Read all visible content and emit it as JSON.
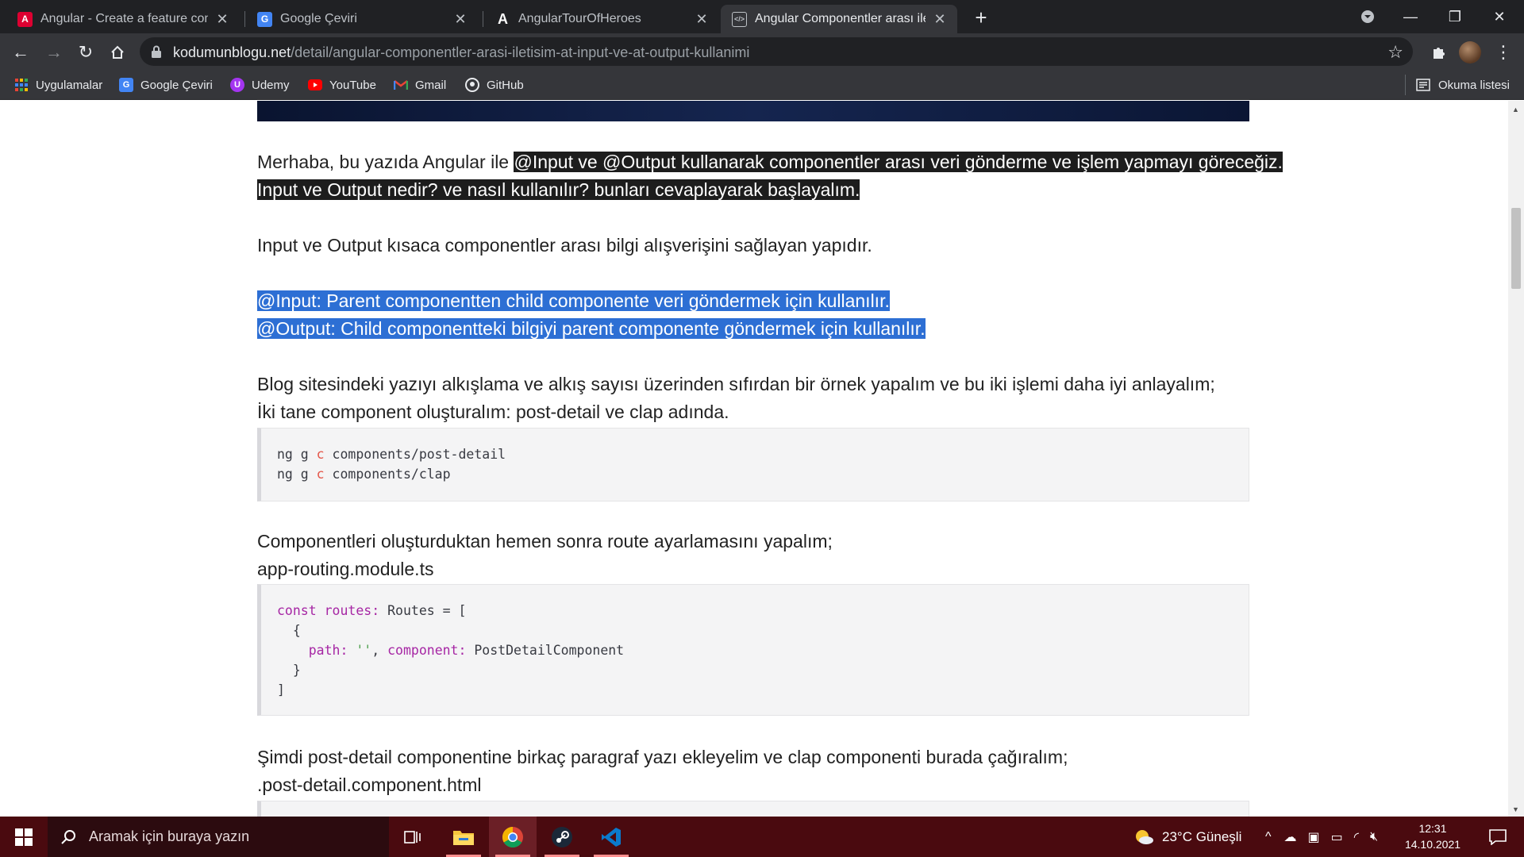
{
  "browser": {
    "tabs": [
      {
        "title": "Angular - Create a feature component",
        "favicon": "angular-red-icon",
        "active": false
      },
      {
        "title": "Google Çeviri",
        "favicon": "google-translate-icon",
        "active": false
      },
      {
        "title": "AngularTourOfHeroes",
        "favicon": "angular-a-icon",
        "active": false
      },
      {
        "title": "Angular Componentler arası iletişim",
        "favicon": "code-icon",
        "active": true
      }
    ],
    "new_tab": "+",
    "window_controls": {
      "minimize": "—",
      "restore": "❐",
      "close": "✕"
    },
    "url_host": "kodumunblogu.net",
    "url_path": "/detail/angular-componentler-arasi-iletisim-at-input-ve-at-output-kullanimi",
    "bookmarks": [
      {
        "label": "Uygulamalar",
        "icon": "apps-grid-icon"
      },
      {
        "label": "Google Çeviri",
        "icon": "google-translate-icon"
      },
      {
        "label": "Udemy",
        "icon": "udemy-icon"
      },
      {
        "label": "YouTube",
        "icon": "youtube-icon"
      },
      {
        "label": "Gmail",
        "icon": "gmail-icon"
      },
      {
        "label": "GitHub",
        "icon": "github-icon"
      }
    ],
    "reading_list": "Okuma listesi"
  },
  "article": {
    "p1_plain": "Merhaba, bu yazıda Angular ile ",
    "p1_highlight": "@Input ve @Output kullanarak componentler arası veri gönderme ve işlem yapmayı göreceğiz.",
    "p1_line2": "Input ve Output nedir? ve nasıl kullanılır? bunları cevaplayarak başlayalım.",
    "p2": "Input ve Output kısaca componentler arası bilgi alışverişini sağlayan yapıdır.",
    "input_def": "@Input: Parent componentten child componente veri göndermek için kullanılır.",
    "output_def": "@Output: Child componentteki bilgiyi parent componente göndermek için kullanılır.",
    "p3_line1": "Blog sitesindeki yazıyı alkışlama ve alkış sayısı üzerinden sıfırdan bir örnek yapalım ve bu iki işlemi daha iyi anlayalım;",
    "p3_line2": "İki tane component oluşturalım: post-detail ve clap adında.",
    "code1": {
      "line1_a": "ng g ",
      "line1_b": "c",
      "line1_c": " components/post-detail",
      "line2_a": "ng g ",
      "line2_b": "c",
      "line2_c": " components/clap"
    },
    "p4_line1": "Componentleri oluşturduktan hemen sonra route ayarlamasını yapalım;",
    "p4_line2": "app-routing.module.ts",
    "code2": {
      "l1_kw": "const",
      "l1_var": " routes",
      "l1_colon": ":",
      "l1_rest": " Routes = [",
      "l2": "  {",
      "l3_prop1": "    path:",
      "l3_str": " ''",
      "l3_comma": ",",
      "l3_prop2": " component:",
      "l3_val": " PostDetailComponent",
      "l4": "  }",
      "l5": "]"
    },
    "p5_line1": "Şimdi post-detail componentine birkaç paragraf yazı ekleyelim ve clap componenti burada çağıralım;",
    "p5_line2": ".post-detail.component.html"
  },
  "taskbar": {
    "search_placeholder": "Aramak için buraya yazın",
    "weather": "23°C  Güneşli",
    "time": "12:31",
    "date": "14.10.2021",
    "apps": [
      "task-view-icon",
      "file-explorer-icon",
      "chrome-icon",
      "steam-icon",
      "vscode-icon"
    ]
  },
  "colors": {
    "highlight_dark": "#1d1d1d",
    "highlight_blue": "#2d6fd4",
    "taskbar": "#4a0a0f",
    "chrome_dark": "#202124"
  }
}
